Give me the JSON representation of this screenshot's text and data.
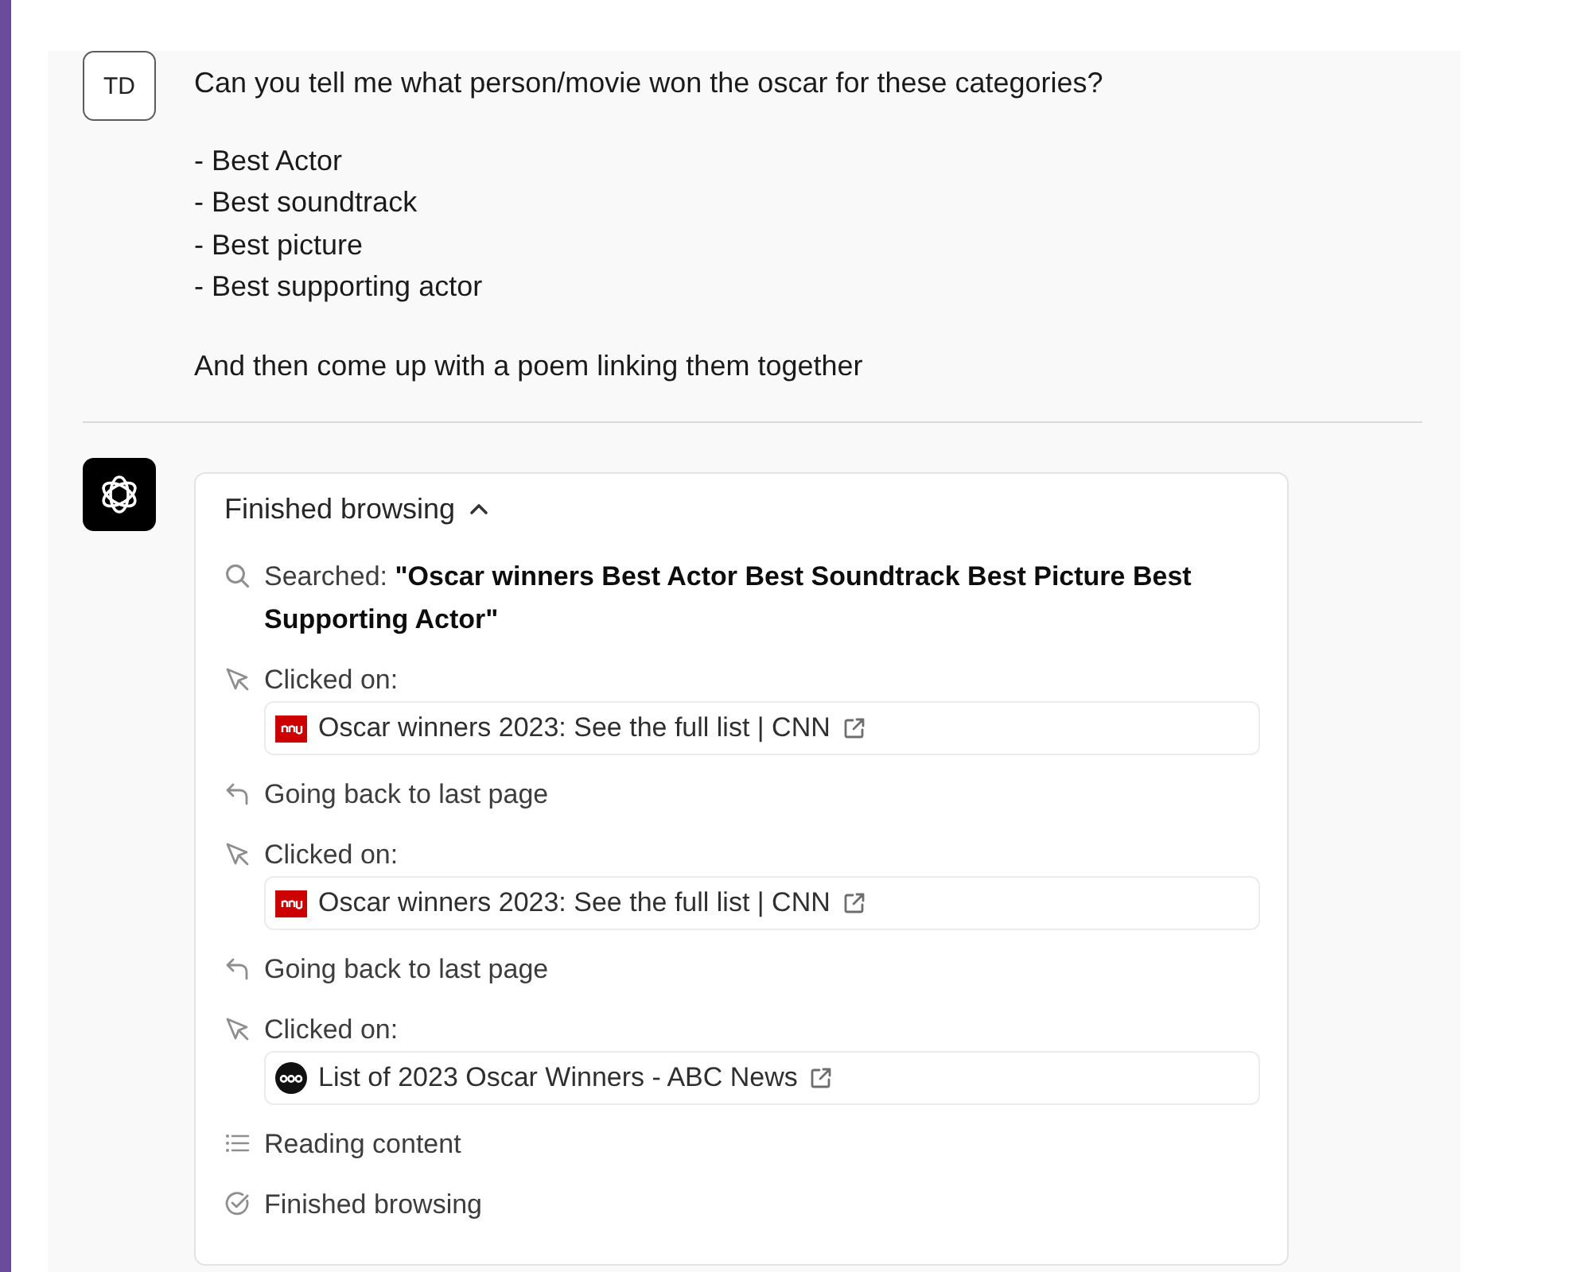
{
  "user_message": {
    "avatar": "TD",
    "intro": "Can you tell me what person/movie won the oscar for these categories?",
    "list": [
      "- Best Actor",
      "- Best soundtrack",
      "- Best picture",
      "- Best supporting actor"
    ],
    "closing": "And then come up with a poem linking them together"
  },
  "assistant_message": {
    "browsing": {
      "title": "Finished browsing",
      "expanded": true,
      "steps": [
        {
          "kind": "search",
          "text": "Searched: **\"Oscar winners Best Actor Best Soundtrack Best Picture Best Supporting Actor\"**"
        },
        {
          "kind": "click",
          "text": "Clicked on:",
          "link": {
            "kind": "tile",
            "color": "#cc0000",
            "title": "Oscar winners 2023: See the full list | CNN"
          }
        },
        {
          "kind": "back",
          "text": "Going back to last page"
        },
        {
          "kind": "click",
          "text": "Clicked on:",
          "link": {
            "kind": "tile",
            "color": "#cc0000",
            "title": "Oscar winners 2023: See the full list | CNN"
          }
        },
        {
          "kind": "back",
          "text": "Going back to last page"
        },
        {
          "kind": "click",
          "text": "Clicked on:",
          "link": {
            "kind": "disc",
            "color": "#111111",
            "title": "List of 2023 Oscar Winners - ABC News"
          }
        },
        {
          "kind": "reading",
          "text": "Reading content"
        },
        {
          "kind": "done",
          "text": "Finished browsing"
        }
      ]
    }
  }
}
